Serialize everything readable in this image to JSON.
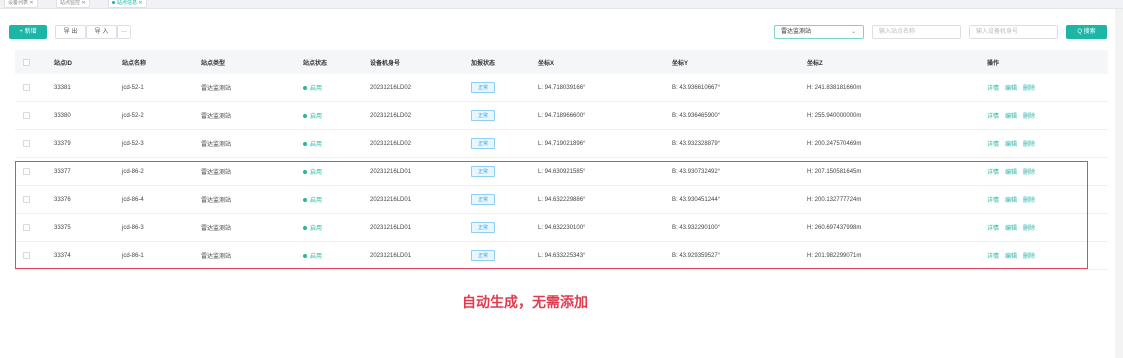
{
  "tabs": [
    {
      "label": "设备列表",
      "active": false
    },
    {
      "label": "站点监控",
      "active": false
    },
    {
      "label": "站点信息",
      "active": true
    }
  ],
  "toolbar": {
    "add_label": "+ 新增",
    "export_label": "导 出",
    "import_label": "导 入",
    "more_label": "···",
    "search_label": "Q 搜索"
  },
  "filters": {
    "station_type_value": "雷达监测站",
    "station_name_placeholder": "输入站点名称",
    "device_no_placeholder": "输入设备机身号"
  },
  "table": {
    "headers": [
      "站点ID",
      "站点名称",
      "站点类型",
      "站点状态",
      "设备机身号",
      "加报状态",
      "坐标X",
      "坐标Y",
      "坐标Z",
      "操作"
    ],
    "rows": [
      {
        "id": "33381",
        "name": "jcd-52-1",
        "type": "雷达监测站",
        "status": "启用",
        "device": "20231216LD02",
        "report": "正常",
        "x": "L: 94.718039166°",
        "y": "B: 43.936610667°",
        "z": "H: 241.838181660m"
      },
      {
        "id": "33380",
        "name": "jcd-52-2",
        "type": "雷达监测站",
        "status": "启用",
        "device": "20231216LD02",
        "report": "正常",
        "x": "L: 94.718966600°",
        "y": "B: 43.936465900°",
        "z": "H: 255.940000000m"
      },
      {
        "id": "33379",
        "name": "jcd-52-3",
        "type": "雷达监测站",
        "status": "启用",
        "device": "20231216LD02",
        "report": "正常",
        "x": "L: 94.719021896°",
        "y": "B: 43.932328879°",
        "z": "H: 200.247570469m"
      },
      {
        "id": "33377",
        "name": "jcd-86-2",
        "type": "雷达监测站",
        "status": "启用",
        "device": "20231216LD01",
        "report": "正常",
        "x": "L: 94.630921585°",
        "y": "B: 43.930732492°",
        "z": "H: 207.150581645m"
      },
      {
        "id": "33376",
        "name": "jcd-86-4",
        "type": "雷达监测站",
        "status": "启用",
        "device": "20231216LD01",
        "report": "正常",
        "x": "L: 94.632229886°",
        "y": "B: 43.930451244°",
        "z": "H: 200.132777724m"
      },
      {
        "id": "33375",
        "name": "jcd-86-3",
        "type": "雷达监测站",
        "status": "启用",
        "device": "20231216LD01",
        "report": "正常",
        "x": "L: 94.632230100°",
        "y": "B: 43.932290100°",
        "z": "H: 260.697437998m"
      },
      {
        "id": "33374",
        "name": "jcd-86-1",
        "type": "雷达监测站",
        "status": "启用",
        "device": "20231216LD01",
        "report": "正常",
        "x": "L: 94.633225343°",
        "y": "B: 43.929359527°",
        "z": "H: 201.982299071m"
      }
    ],
    "ops": [
      "详情",
      "编辑",
      "删除"
    ]
  },
  "annotation": "自动生成，无需添加",
  "colors": {
    "accent": "#1cb5a6",
    "highlight": "#e2475e"
  }
}
